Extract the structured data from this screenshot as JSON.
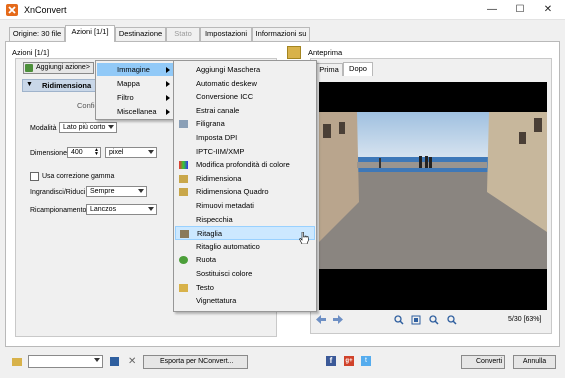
{
  "window": {
    "title": "XnConvert",
    "minimize": "—",
    "maximize": "☐",
    "close": "✕"
  },
  "tabs": [
    {
      "label": "Origine: 30 file"
    },
    {
      "label": "Azioni [1/1]"
    },
    {
      "label": "Destinazione"
    },
    {
      "label": "Stato"
    },
    {
      "label": "Impostazioni"
    },
    {
      "label": "Informazioni su"
    }
  ],
  "actions": {
    "group_label": "Azioni [1/1]",
    "add_button": "Aggiungi azione>",
    "current_action": "Ridimensiona",
    "config_tab": "Config",
    "modality_label": "Modalità",
    "modality_value": "Lato più corto",
    "dimension_label": "Dimensione",
    "dimension_value": "400",
    "dimension_unit": "pixel",
    "gamma_label": "Usa correzione gamma",
    "enlarge_label": "Ingrandisci/Riduci",
    "enlarge_value": "Sempre",
    "resample_label": "Ricampionamento",
    "resample_value": "Lanczos"
  },
  "menu": {
    "items": [
      {
        "label": "Immagine"
      },
      {
        "label": "Mappa"
      },
      {
        "label": "Filtro"
      },
      {
        "label": "Miscellanea"
      }
    ],
    "submenu": [
      {
        "label": "Aggiungi Maschera"
      },
      {
        "label": "Automatic deskew"
      },
      {
        "label": "Conversione ICC"
      },
      {
        "label": "Estrai canale"
      },
      {
        "label": "Filigrana"
      },
      {
        "label": "Imposta DPI"
      },
      {
        "label": "IPTC-IIM/XMP"
      },
      {
        "label": "Modifica profondità di colore"
      },
      {
        "label": "Ridimensiona"
      },
      {
        "label": "Ridimensiona Quadro"
      },
      {
        "label": "Rimuovi metadati"
      },
      {
        "label": "Rispecchia"
      },
      {
        "label": "Ritaglia"
      },
      {
        "label": "Ritaglio automatico"
      },
      {
        "label": "Ruota"
      },
      {
        "label": "Sostituisci colore"
      },
      {
        "label": "Testo"
      },
      {
        "label": "Vignettatura"
      }
    ]
  },
  "preview": {
    "label": "Anteprima",
    "tab_before": "Prima",
    "tab_after": "Dopo",
    "zoom_info": "5/30 [63%]"
  },
  "bottom": {
    "export_label": "Esporta per NConvert...",
    "convert_label": "Converti",
    "cancel_label": "Annulla"
  }
}
